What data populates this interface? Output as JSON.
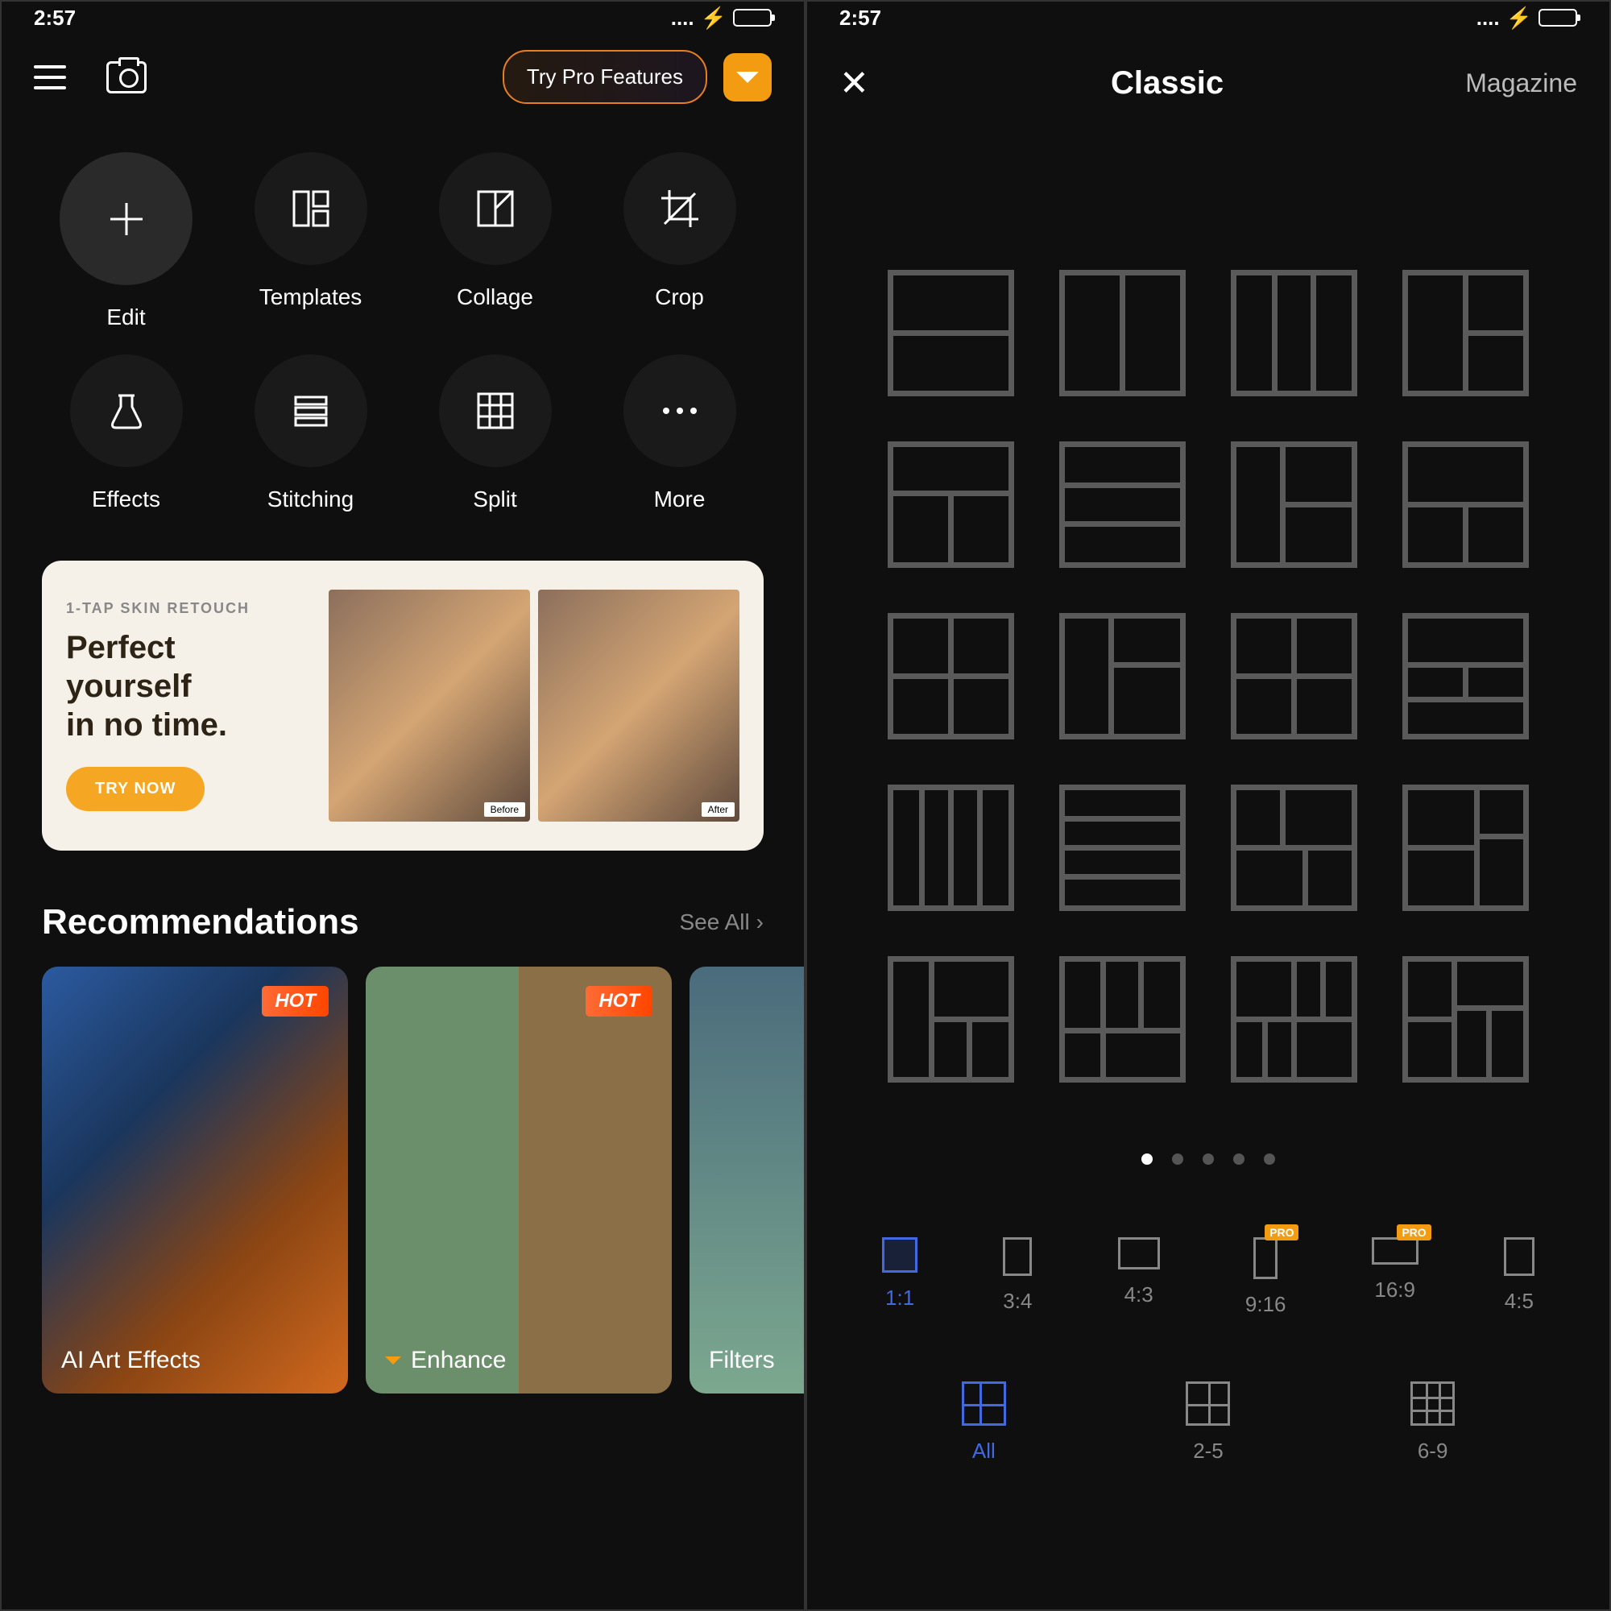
{
  "status": {
    "time": "2:57",
    "signal_dots": "....",
    "lightning": "⚡"
  },
  "left": {
    "header": {
      "try_pro": "Try Pro Features"
    },
    "tools": [
      {
        "id": "edit",
        "label": "Edit",
        "icon": "plus",
        "highlight": true
      },
      {
        "id": "templates",
        "label": "Templates",
        "icon": "templates"
      },
      {
        "id": "collage",
        "label": "Collage",
        "icon": "collage"
      },
      {
        "id": "crop",
        "label": "Crop",
        "icon": "crop"
      },
      {
        "id": "effects",
        "label": "Effects",
        "icon": "flask"
      },
      {
        "id": "stitching",
        "label": "Stitching",
        "icon": "lines"
      },
      {
        "id": "split",
        "label": "Split",
        "icon": "grid3"
      },
      {
        "id": "more",
        "label": "More",
        "icon": "dots"
      }
    ],
    "promo": {
      "eyebrow": "1-TAP SKIN RETOUCH",
      "title_line1": "Perfect",
      "title_line2": "yourself",
      "title_line3": "in no time.",
      "cta": "TRY NOW",
      "before": "Before",
      "after": "After"
    },
    "recommendations": {
      "title": "Recommendations",
      "see_all": "See All",
      "items": [
        {
          "label": "AI Art Effects",
          "badge": "HOT"
        },
        {
          "label": "Enhance",
          "badge": "HOT",
          "diamond": true
        },
        {
          "label": "Filters"
        }
      ]
    }
  },
  "right": {
    "header": {
      "title": "Classic",
      "magazine": "Magazine"
    },
    "page_dots": {
      "count": 5,
      "active": 0
    },
    "ratios": [
      {
        "label": "1:1",
        "active": true,
        "w": 44,
        "h": 44
      },
      {
        "label": "3:4",
        "w": 36,
        "h": 48
      },
      {
        "label": "4:3",
        "w": 52,
        "h": 40
      },
      {
        "label": "9:16",
        "w": 30,
        "h": 52,
        "pro": "PRO"
      },
      {
        "label": "16:9",
        "w": 58,
        "h": 34,
        "pro": "PRO"
      },
      {
        "label": "4:5",
        "w": 38,
        "h": 48
      }
    ],
    "grid_types": [
      {
        "label": "All",
        "active": true
      },
      {
        "label": "2-5"
      },
      {
        "label": "6-9"
      }
    ]
  }
}
